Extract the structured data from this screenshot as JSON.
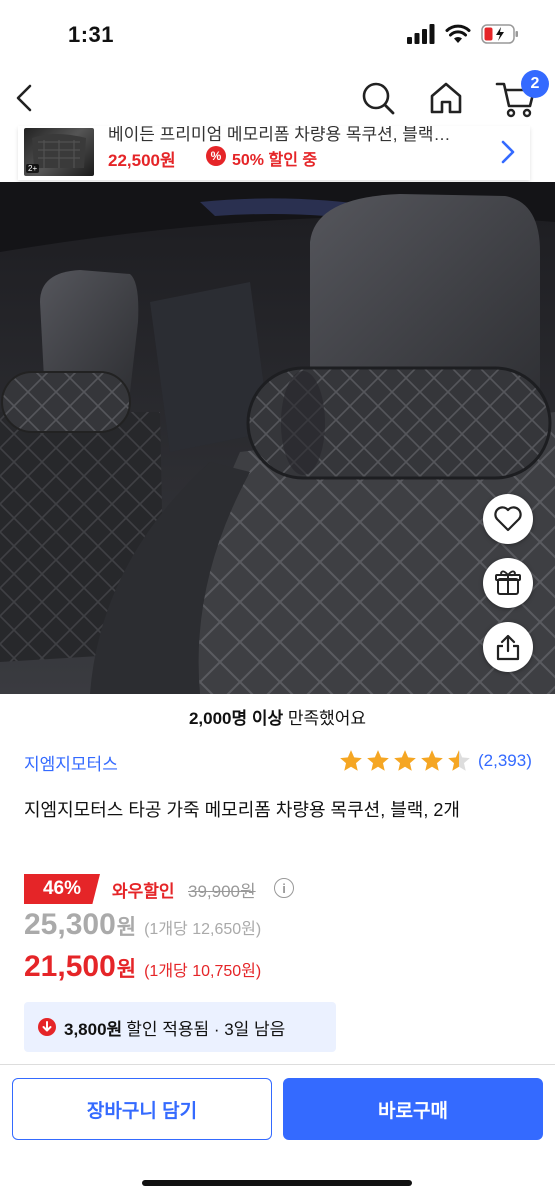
{
  "status_bar": {
    "time": "1:31"
  },
  "nav": {
    "cart_count": "2"
  },
  "mini_banner": {
    "title": "베이든 프리미엄 메모리폼 차량용 목쿠션, 블랙…",
    "price": "22,500원",
    "discount": "50% 할인 중",
    "thumb_badge": "2+"
  },
  "satisfaction": {
    "count": "2,000명 이상",
    "text": " 만족했어요"
  },
  "product": {
    "brand": "지엠지모터스",
    "rating": 4.5,
    "review_count": "(2,393)",
    "title": "지엠지모터스 타공 가죽 메모리폼 차량용 목쿠션, 블랙, 2개",
    "discount_badge": "46%",
    "wow_label": "와우할인",
    "original_price": "39,900원",
    "price1_num": "25,300",
    "price1_won": "원",
    "price1_unit": "(1개당 12,650원)",
    "price2_num": "21,500",
    "price2_won": "원",
    "price2_unit": "(1개당 10,750원)"
  },
  "coupon": {
    "amount": "3,800원",
    "rest": "할인 적용됨 · 3일 남음"
  },
  "actions": {
    "cart_label": "장바구니 담기",
    "buy_label": "바로구매"
  },
  "colors": {
    "accent": "#346aff",
    "sale": "#e52528",
    "star": "#f5a623"
  },
  "icons": [
    "signal-icon",
    "wifi-icon",
    "battery-icon",
    "back-icon",
    "search-icon",
    "home-icon",
    "cart-icon",
    "chevron-right-icon",
    "heart-icon",
    "gift-icon",
    "share-icon",
    "star-icon",
    "info-icon",
    "down-arrow-icon"
  ]
}
